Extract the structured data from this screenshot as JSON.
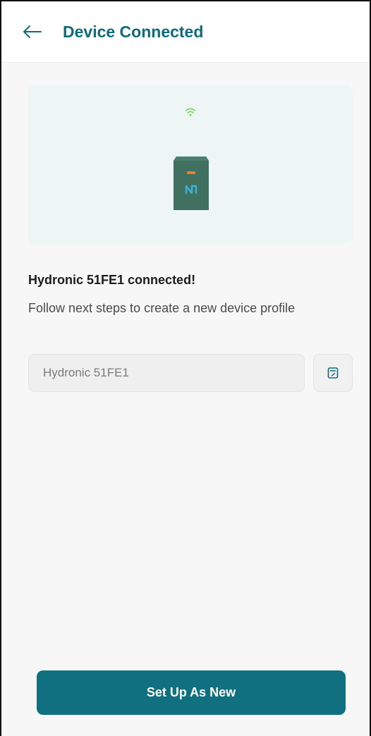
{
  "header": {
    "title": "Device Connected",
    "back_icon": "arrow-left-icon"
  },
  "hero": {
    "wifi_icon": "wifi-icon",
    "device_icon": "hydronic-device-icon"
  },
  "status": {
    "title": "Hydronic 51FE1 connected!",
    "subtitle": "Follow next steps to create a new device profile"
  },
  "device_name": {
    "value": "Hydronic 51FE1",
    "edit_icon": "edit-name-icon"
  },
  "actions": {
    "primary_label": "Set Up As New"
  },
  "colors": {
    "accent": "#11707f",
    "title": "#0e6b7a",
    "device_body": "#3f7060",
    "device_indicator": "#f07f28",
    "device_logo": "#3ab5d8",
    "wifi": "#7ed957"
  }
}
